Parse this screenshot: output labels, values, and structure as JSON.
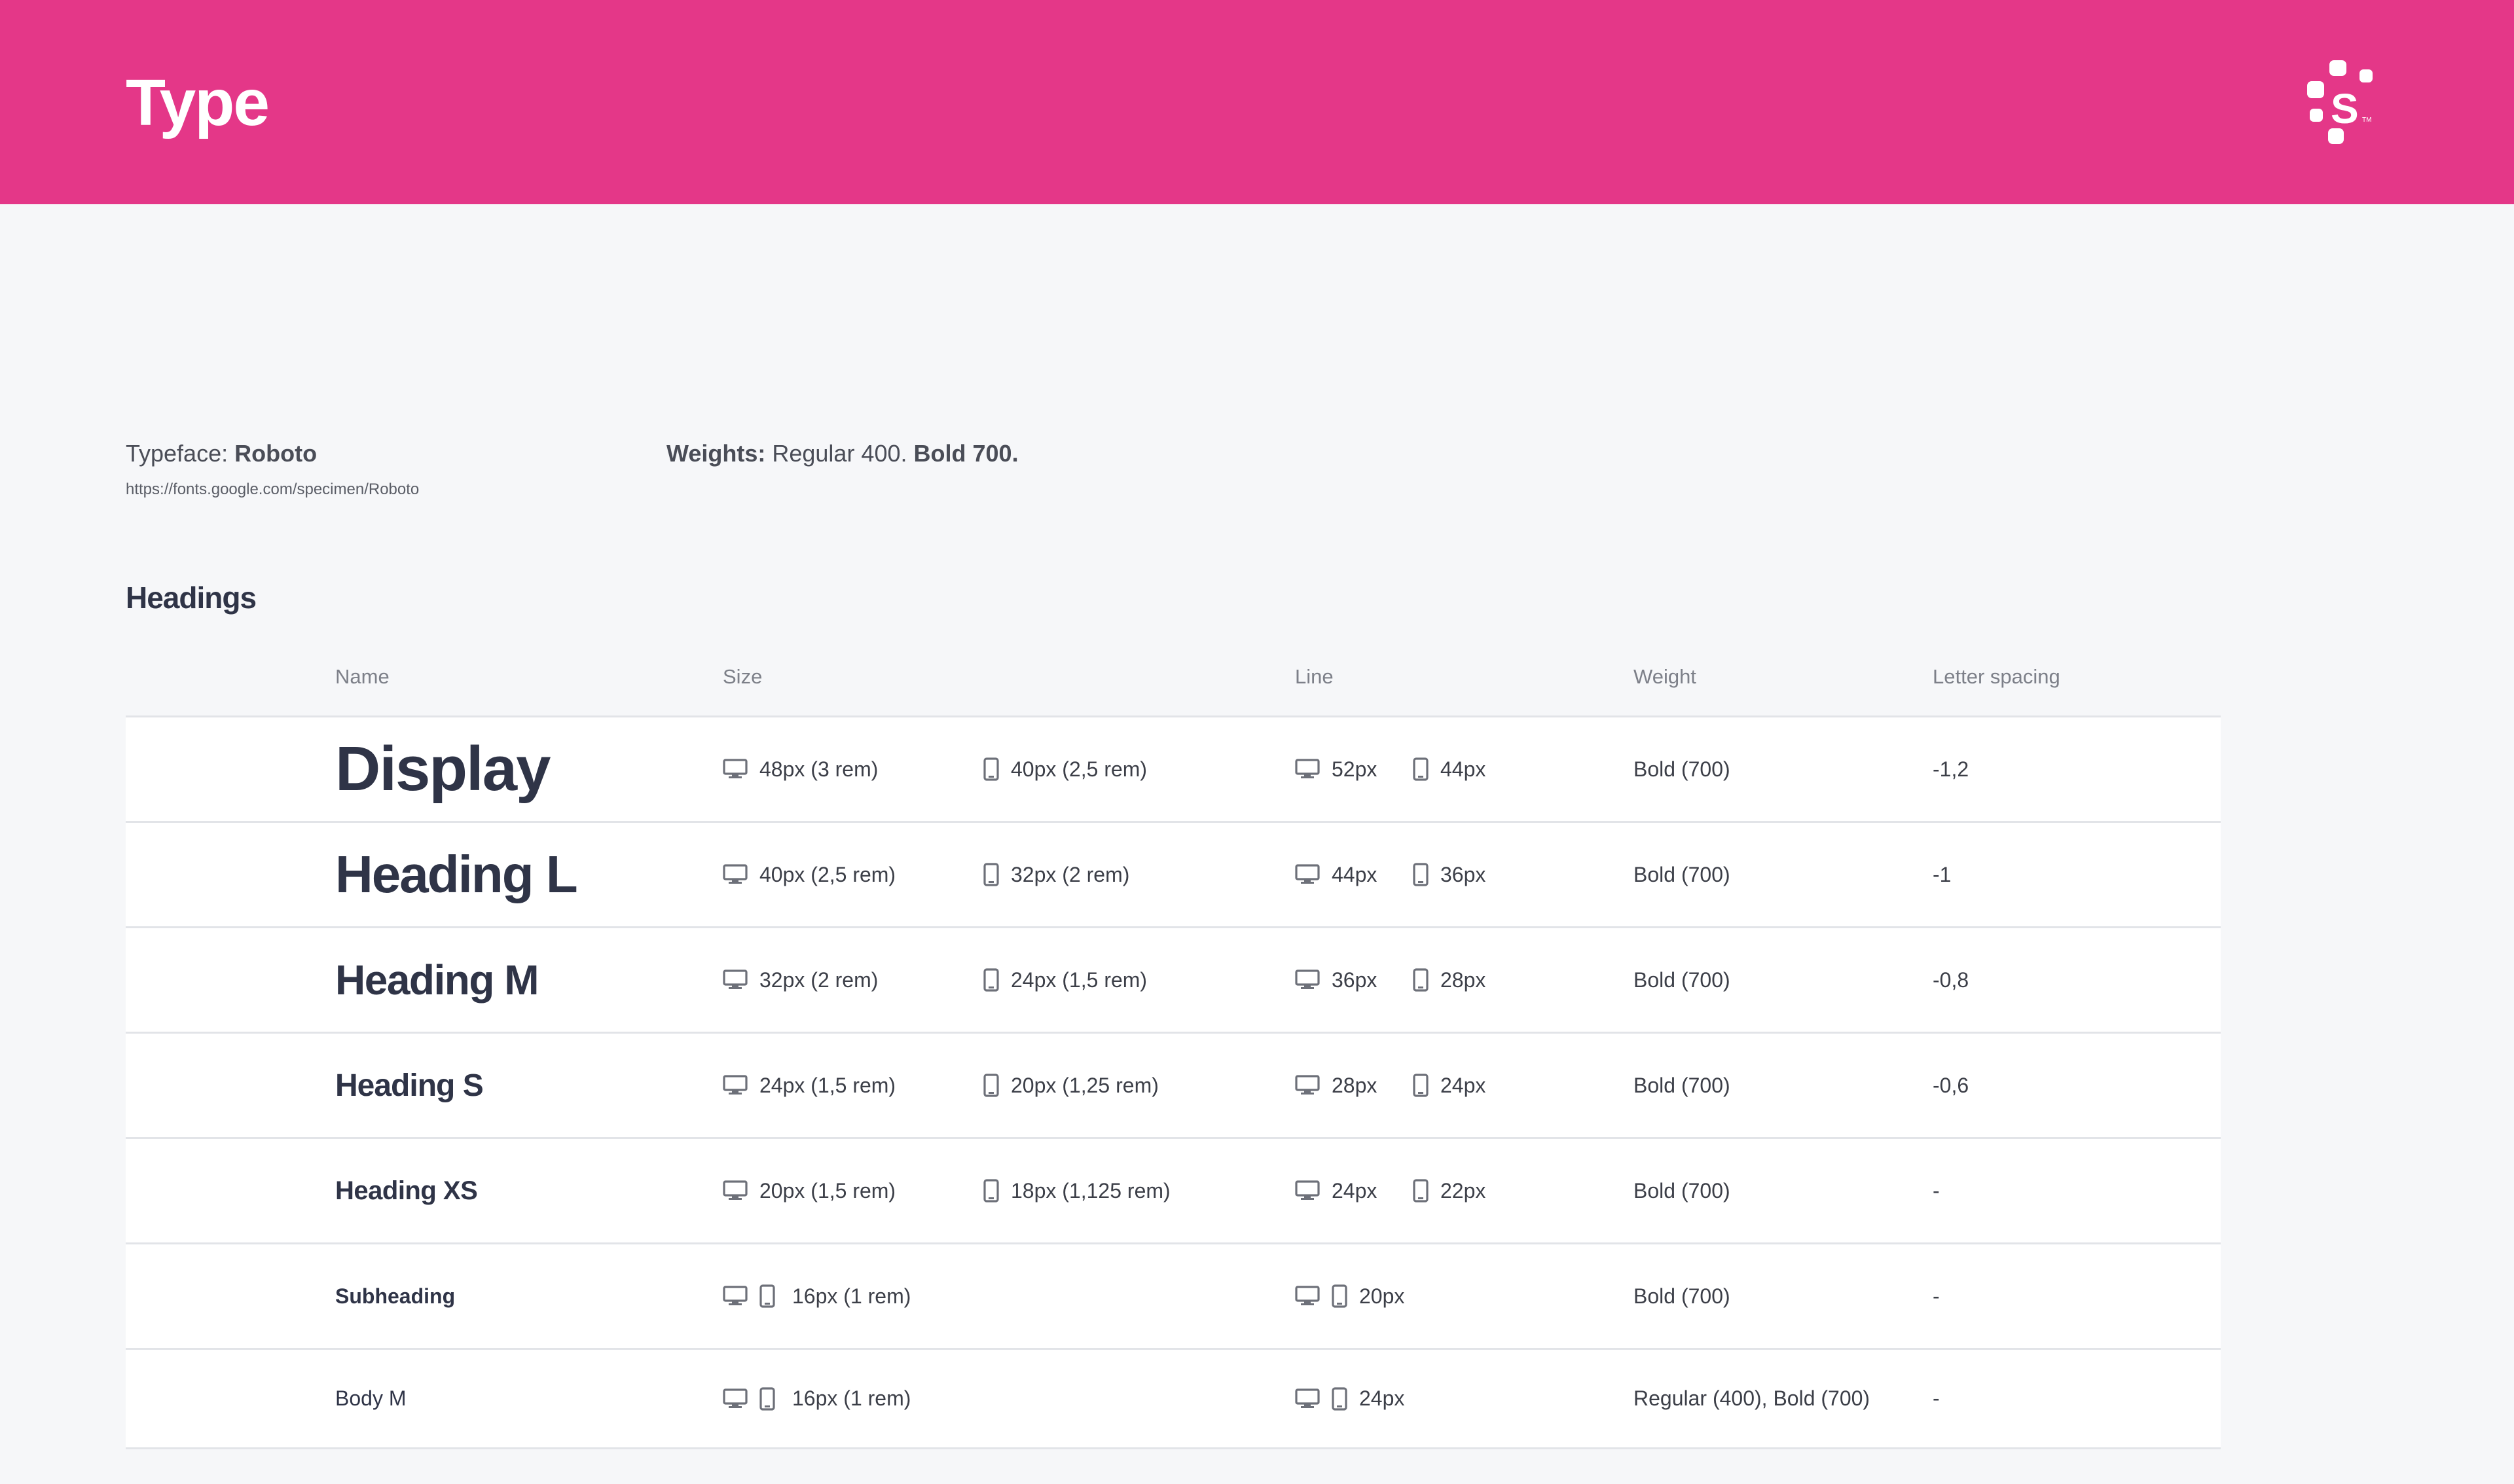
{
  "header": {
    "title": "Type",
    "logo_letter": "S",
    "bg_color": "#e43788"
  },
  "typeface": {
    "label": "Typeface:",
    "name": "Roboto",
    "url": "https://fonts.google.com/specimen/Roboto"
  },
  "weights": {
    "label": "Weights:",
    "regular": "Regular 400.",
    "bold": "Bold 700."
  },
  "section": {
    "title": "Headings"
  },
  "table": {
    "columns": {
      "name": "Name",
      "size": "Size",
      "line": "Line",
      "weight": "Weight",
      "spacing": "Letter spacing"
    },
    "rows": [
      {
        "name": "Display",
        "size_desktop": "48px (3 rem)",
        "size_mobile": "40px (2,5 rem)",
        "line_desktop": "52px",
        "line_mobile": "44px",
        "weight": "Bold (700)",
        "spacing": "-1,2"
      },
      {
        "name": "Heading L",
        "size_desktop": "40px (2,5 rem)",
        "size_mobile": "32px (2 rem)",
        "line_desktop": "44px",
        "line_mobile": "36px",
        "weight": "Bold (700)",
        "spacing": "-1"
      },
      {
        "name": "Heading M",
        "size_desktop": "32px (2 rem)",
        "size_mobile": "24px (1,5 rem)",
        "line_desktop": "36px",
        "line_mobile": "28px",
        "weight": "Bold (700)",
        "spacing": "-0,8"
      },
      {
        "name": "Heading S",
        "size_desktop": "24px (1,5 rem)",
        "size_mobile": "20px (1,25 rem)",
        "line_desktop": "28px",
        "line_mobile": "24px",
        "weight": "Bold (700)",
        "spacing": "-0,6"
      },
      {
        "name": "Heading XS",
        "size_desktop": "20px (1,5 rem)",
        "size_mobile": "18px (1,125 rem)",
        "line_desktop": "24px",
        "line_mobile": "22px",
        "weight": "Bold (700)",
        "spacing": "-"
      },
      {
        "name": "Subheading",
        "size_both": "16px (1 rem)",
        "line_both": "20px",
        "weight": "Bold (700)",
        "spacing": "-"
      },
      {
        "name": "Body M",
        "size_both": "16px (1 rem)",
        "line_both": "24px",
        "weight": "Regular (400), Bold (700)",
        "spacing": "-"
      }
    ]
  },
  "icons": {
    "desktop": "desktop-icon",
    "mobile": "mobile-icon"
  }
}
